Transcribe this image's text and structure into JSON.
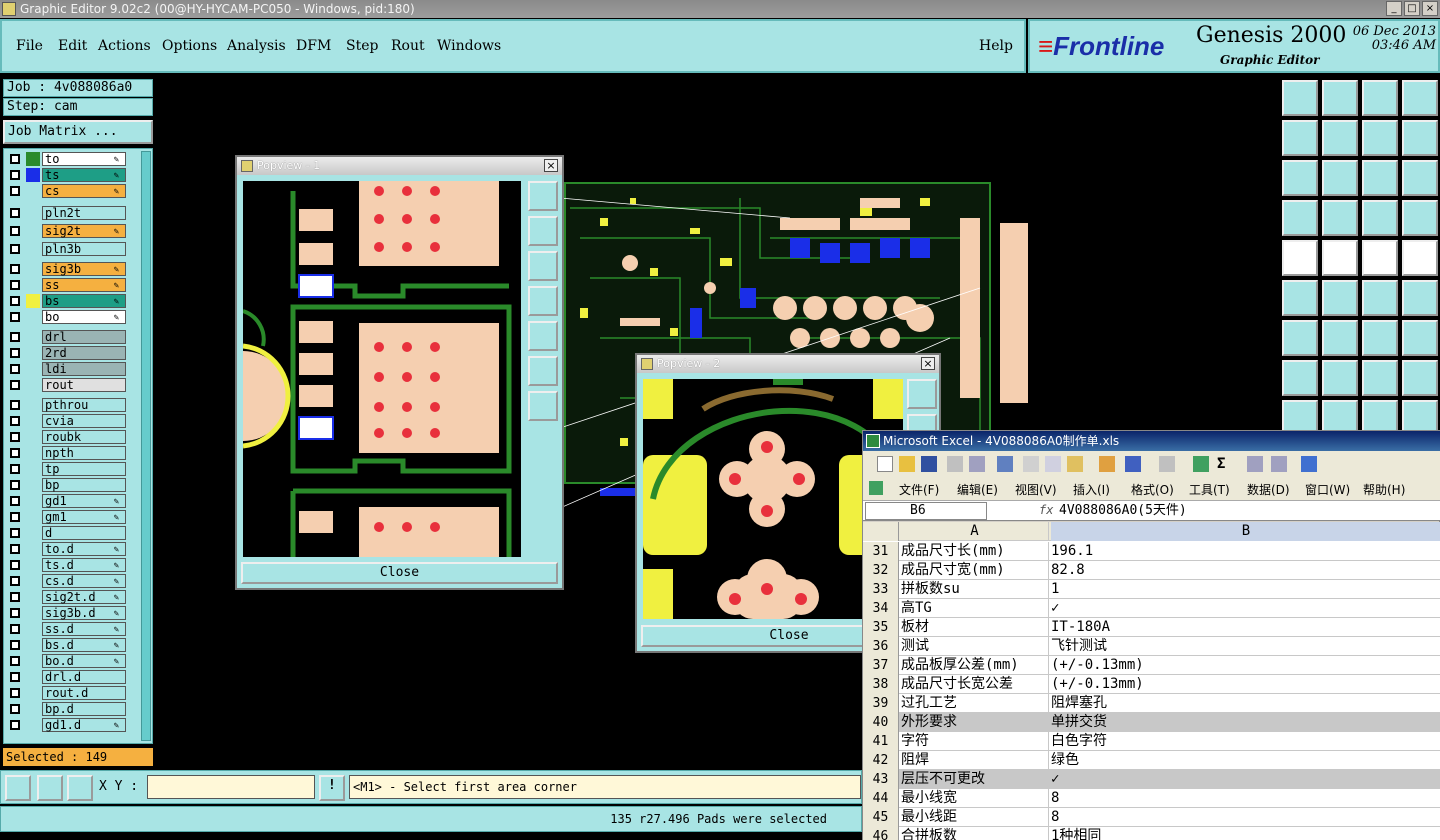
{
  "window": {
    "title": "Graphic Editor 9.02c2 (00@HY-HYCAM-PC050 - Windows, pid:180)"
  },
  "menu": {
    "items": [
      "File",
      "Edit",
      "Actions",
      "Options",
      "Analysis",
      "DFM",
      "Step",
      "Rout",
      "Windows"
    ],
    "help": "Help"
  },
  "brand": {
    "logo_prefix": "Frontline",
    "product": "Genesis 2000",
    "subtitle": "Graphic Editor",
    "date": "06 Dec 2013",
    "time": "03:46 AM"
  },
  "job": {
    "job_label": "Job : 4v088086a0",
    "step_label": "Step: cam",
    "matrix_button": "Job Matrix ..."
  },
  "layers": [
    {
      "name": "to",
      "color": "#ffffff",
      "swatch": "#2a8a2a",
      "editable": true
    },
    {
      "name": "ts",
      "color": "#1e9e86",
      "swatch": "#1a2ee8",
      "editable": true
    },
    {
      "name": "cs",
      "color": "#f5b040",
      "swatch": "",
      "editable": true
    },
    {
      "name": "pln2t",
      "color": "#a8e4e4",
      "swatch": "",
      "editable": false
    },
    {
      "name": "sig2t",
      "color": "#f5b040",
      "swatch": "",
      "editable": true
    },
    {
      "name": "pln3b",
      "color": "#a8e4e4",
      "swatch": "",
      "editable": false
    },
    {
      "name": "sig3b",
      "color": "#f5b040",
      "swatch": "",
      "editable": true
    },
    {
      "name": "ss",
      "color": "#f5b040",
      "swatch": "",
      "editable": true
    },
    {
      "name": "bs",
      "color": "#1e9e86",
      "swatch": "#f0f040",
      "editable": true
    },
    {
      "name": "bo",
      "color": "#ffffff",
      "swatch": "",
      "editable": true
    },
    {
      "name": "drl",
      "color": "#9ab4b4",
      "swatch": "",
      "editable": false
    },
    {
      "name": "2rd",
      "color": "#9ab4b4",
      "swatch": "",
      "editable": false
    },
    {
      "name": "ldi",
      "color": "#9ab4b4",
      "swatch": "",
      "editable": false
    },
    {
      "name": "rout",
      "color": "#e0e0e0",
      "swatch": "",
      "editable": false
    },
    {
      "name": "pthrou",
      "color": "#a8e4e4",
      "swatch": "",
      "editable": false
    },
    {
      "name": "cvia",
      "color": "#a8e4e4",
      "swatch": "",
      "editable": false
    },
    {
      "name": "roubk",
      "color": "#a8e4e4",
      "swatch": "",
      "editable": false
    },
    {
      "name": "npth",
      "color": "#a8e4e4",
      "swatch": "",
      "editable": false
    },
    {
      "name": "tp",
      "color": "#a8e4e4",
      "swatch": "",
      "editable": false
    },
    {
      "name": "bp",
      "color": "#a8e4e4",
      "swatch": "",
      "editable": false
    },
    {
      "name": "gd1",
      "color": "#a8e4e4",
      "swatch": "",
      "editable": true
    },
    {
      "name": "gm1",
      "color": "#a8e4e4",
      "swatch": "",
      "editable": true
    },
    {
      "name": "d",
      "color": "#a8e4e4",
      "swatch": "",
      "editable": false
    },
    {
      "name": "to.d",
      "color": "#a8e4e4",
      "swatch": "",
      "editable": true
    },
    {
      "name": "ts.d",
      "color": "#a8e4e4",
      "swatch": "",
      "editable": true
    },
    {
      "name": "cs.d",
      "color": "#a8e4e4",
      "swatch": "",
      "editable": true
    },
    {
      "name": "sig2t.d",
      "color": "#a8e4e4",
      "swatch": "",
      "editable": true
    },
    {
      "name": "sig3b.d",
      "color": "#a8e4e4",
      "swatch": "",
      "editable": true
    },
    {
      "name": "ss.d",
      "color": "#a8e4e4",
      "swatch": "",
      "editable": true
    },
    {
      "name": "bs.d",
      "color": "#a8e4e4",
      "swatch": "",
      "editable": true
    },
    {
      "name": "bo.d",
      "color": "#a8e4e4",
      "swatch": "",
      "editable": true
    },
    {
      "name": "drl.d",
      "color": "#a8e4e4",
      "swatch": "",
      "editable": false
    },
    {
      "name": "rout.d",
      "color": "#a8e4e4",
      "swatch": "",
      "editable": false
    },
    {
      "name": "bp.d",
      "color": "#a8e4e4",
      "swatch": "",
      "editable": false
    },
    {
      "name": "gd1.d",
      "color": "#a8e4e4",
      "swatch": "",
      "editable": true
    }
  ],
  "selected": "Selected : 149",
  "bottom": {
    "xy_label": "X Y :",
    "xy_value": "",
    "prompt": "<M1> - Select first area corner",
    "status": "135 r27.496 Pads were selected"
  },
  "popview1": {
    "title": "Popview - 1",
    "close": "Close"
  },
  "popview2": {
    "title": "Popview - 2",
    "close": "Close"
  },
  "excel": {
    "title": "Microsoft Excel - 4V088086A0制作单.xls",
    "menus": [
      "文件(F)",
      "编辑(E)",
      "视图(V)",
      "插入(I)",
      "格式(O)",
      "工具(T)",
      "数据(D)",
      "窗口(W)",
      "帮助(H)"
    ],
    "namebox": "B6",
    "fx": "fx",
    "formula": "4V088086A0(5天件)",
    "col_a": "A",
    "col_b": "B",
    "rows": [
      {
        "n": "31",
        "a": "成品尺寸长(mm)",
        "b": "196.1",
        "hl": false
      },
      {
        "n": "32",
        "a": "成品尺寸宽(mm)",
        "b": "82.8",
        "hl": false
      },
      {
        "n": "33",
        "a": "拼板数su",
        "b": "1",
        "hl": false
      },
      {
        "n": "34",
        "a": "高TG",
        "b": "✓",
        "hl": false
      },
      {
        "n": "35",
        "a": "板材",
        "b": "IT-180A",
        "hl": false
      },
      {
        "n": "36",
        "a": "测试",
        "b": "飞针测试",
        "hl": false
      },
      {
        "n": "37",
        "a": "成品板厚公差(mm)",
        "b": "(+/-0.13mm)",
        "hl": false
      },
      {
        "n": "38",
        "a": "成品尺寸长宽公差",
        "b": "(+/-0.13mm)",
        "hl": false
      },
      {
        "n": "39",
        "a": "过孔工艺",
        "b": "阻焊塞孔",
        "hl": false
      },
      {
        "n": "40",
        "a": "外形要求",
        "b": "单拼交货",
        "hl": true
      },
      {
        "n": "41",
        "a": "字符",
        "b": "白色字符",
        "hl": false
      },
      {
        "n": "42",
        "a": "阻焊",
        "b": "绿色",
        "hl": false
      },
      {
        "n": "43",
        "a": "层压不可更改",
        "b": "✓",
        "hl": true
      },
      {
        "n": "44",
        "a": "最小线宽",
        "b": "8",
        "hl": false
      },
      {
        "n": "45",
        "a": "最小线距",
        "b": "8",
        "hl": false
      },
      {
        "n": "46",
        "a": "合拼板数",
        "b": "1种相同",
        "hl": false
      }
    ]
  }
}
